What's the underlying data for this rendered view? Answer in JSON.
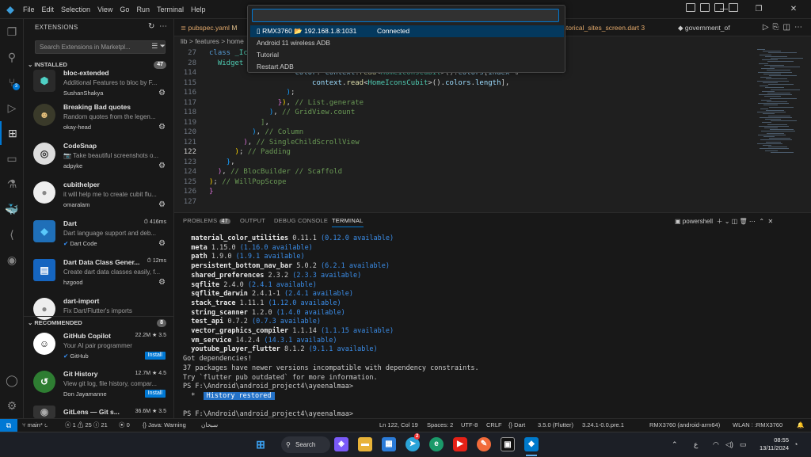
{
  "titlebar": {
    "menus": [
      "File",
      "Edit",
      "Selection",
      "View",
      "Go",
      "Run",
      "Terminal",
      "Help"
    ]
  },
  "quick_pick": {
    "input_value": "",
    "items": [
      {
        "label": "RMX3760 📂 192.168.1.8:1031",
        "status": "Connected"
      },
      {
        "label": "Android 11 wireless ADB"
      },
      {
        "label": "Tutorial"
      },
      {
        "label": "Restart ADB"
      }
    ]
  },
  "sidebar": {
    "title": "EXTENSIONS",
    "search_placeholder": "Search Extensions in Marketpl...",
    "installed_label": "INSTALLED",
    "installed_count": "47",
    "installed": [
      {
        "name": "bloc-extended",
        "desc": "Additional Features to bloc by F...",
        "pub": "SushanShakya",
        "meta": ""
      },
      {
        "name": "Breaking Bad quotes",
        "desc": "Random quotes from the legen...",
        "pub": "okay-head",
        "meta": ""
      },
      {
        "name": "CodeSnap",
        "desc": "📷 Take beautiful screenshots o...",
        "pub": "adpyke",
        "meta": ""
      },
      {
        "name": "cubithelper",
        "desc": "it will help me to create cubit flu...",
        "pub": "omaralam",
        "meta": ""
      },
      {
        "name": "Dart",
        "desc": "Dart language support and deb...",
        "pub": "Dart Code",
        "meta": "416ms"
      },
      {
        "name": "Dart Data Class Gener...",
        "desc": "Create dart data classes easily, f...",
        "pub": "hzgood",
        "meta": "12ms"
      },
      {
        "name": "dart-import",
        "desc": "Fix Dart/Flutter's imports",
        "pub": "",
        "meta": ""
      }
    ],
    "recommended_label": "RECOMMENDED",
    "recommended_count": "8",
    "recommended": [
      {
        "name": "GitHub Copilot",
        "desc": "Your AI pair programmer",
        "pub": "GitHub",
        "meta": "22.2M ★ 3.5",
        "action": "Install"
      },
      {
        "name": "Git History",
        "desc": "View git log, file history, compar...",
        "pub": "Don Jayamanne",
        "meta": "12.7M ★ 4.5",
        "action": "Install"
      },
      {
        "name": "GitLens — Git s...",
        "desc": "",
        "pub": "",
        "meta": "36.6M ★ 3.5",
        "action": ""
      }
    ]
  },
  "tabs": [
    {
      "label": "pubspec.yaml",
      "mark": "M"
    },
    {
      "label": "historical_sites_screen.dart",
      "mark": "3"
    },
    {
      "label": "government_of"
    }
  ],
  "breadcrumb": "lib > features > home",
  "editor": {
    "lines": [
      {
        "n": "27",
        "html": "<span class='c-kw'>class</span> <span class='c-ty'>_Ico</span>"
      },
      {
        "n": "28",
        "html": "  <span class='c-ty'>Widget</span> b"
      },
      {
        "n": "114",
        "html": "                    <span class='c-va'>color</span>: <span class='c-va'>context</span>.<span class='c-fn'>read</span>&lt;<span class='c-ty'>HomeIconsCubit</span>&gt;().<span class='c-va'>colors</span>[<span class='c-va'>index</span> %"
      },
      {
        "n": "115",
        "html": "                        <span class='c-va'>context</span>.<span class='c-fn'>read</span>&lt;<span class='c-ty'>HomeIconsCubit</span>&gt;().<span class='c-va'>colors</span>.<span class='c-va'>length</span>],"
      },
      {
        "n": "116",
        "html": "                  <span class='c-br'>)</span>;"
      },
      {
        "n": "117",
        "html": "                <span class='c-pp'>}</span><span class='c-pn'>)</span>, <span class='c-cm'>// List.generate</span>"
      },
      {
        "n": "118",
        "html": "              <span class='c-br'>)</span>, <span class='c-cm'>// GridView.count</span>"
      },
      {
        "n": "119",
        "html": "            <span class='c-gr'>]</span>,"
      },
      {
        "n": "120",
        "html": "          <span class='c-br'>)</span>, <span class='c-cm'>// Column</span>"
      },
      {
        "n": "121",
        "html": "        <span class='c-pp'>)</span>, <span class='c-cm'>// SingleChildScrollView</span>"
      },
      {
        "n": "122",
        "html": "      <span class='c-pn'>)</span>; <span class='c-cm'>// Padding</span>"
      },
      {
        "n": "123",
        "html": "    <span class='c-br'>}</span>,"
      },
      {
        "n": "124",
        "html": "  <span class='c-pp'>)</span>, <span class='c-cm'>// BlocBuilder // Scaffold</span>"
      },
      {
        "n": "125",
        "html": "<span class='c-pn'>)</span>; <span class='c-cm'>// WillPopScope</span>"
      },
      {
        "n": "126",
        "html": "<span class='c-pp'>}</span>"
      },
      {
        "n": "127",
        "html": ""
      }
    ]
  },
  "panel": {
    "tabs": [
      "PROBLEMS",
      "OUTPUT",
      "DEBUG CONSOLE",
      "TERMINAL"
    ],
    "problems_count": "47",
    "shell": "powershell"
  },
  "terminal": {
    "packages": [
      [
        "material_color_utilities",
        "0.11.1",
        "(0.12.0 available)"
      ],
      [
        "meta",
        "1.15.0",
        "(1.16.0 available)"
      ],
      [
        "path",
        "1.9.0",
        "(1.9.1 available)"
      ],
      [
        "persistent_bottom_nav_bar",
        "5.0.2",
        "(6.2.1 available)"
      ],
      [
        "shared_preferences",
        "2.3.2",
        "(2.3.3 available)"
      ],
      [
        "sqflite",
        "2.4.0",
        "(2.4.1 available)"
      ],
      [
        "sqflite_darwin",
        "2.4.1-1",
        "(2.4.1 available)"
      ],
      [
        "stack_trace",
        "1.11.1",
        "(1.12.0 available)"
      ],
      [
        "string_scanner",
        "1.2.0",
        "(1.4.0 available)"
      ],
      [
        "test_api",
        "0.7.2",
        "(0.7.3 available)"
      ],
      [
        "vector_graphics_compiler",
        "1.1.14",
        "(1.1.15 available)"
      ],
      [
        "vm_service",
        "14.2.4",
        "(14.3.1 available)"
      ],
      [
        "youtube_player_flutter",
        "8.1.2",
        "(9.1.1 available)"
      ]
    ],
    "got": "Got dependencies!",
    "incompatible": "37 packages have newer versions incompatible with dependency constraints.",
    "try": "Try `flutter pub outdated` for more information.",
    "prompt1": "PS F:\\Android\\android_project4\\ayeenalmaa>",
    "history": "History restored",
    "prompt2": "PS F:\\Android\\android_project4\\ayeenalmaa>"
  },
  "status": {
    "branch": "main*",
    "errors": "1",
    "warnings": "25",
    "infos": "21",
    "ports": "0",
    "java": "Java: Warning",
    "arabic": "سبحان",
    "pos": "Ln 122, Col 19",
    "spaces": "Spaces: 2",
    "enc": "UTF-8",
    "eol": "CRLF",
    "lang": "Dart",
    "dartver": "3.5.0 (Flutter)",
    "flutterver": "3.24.1-0.0.pre.1",
    "device": "RMX3760 (android-arm64)",
    "wlan": "WLAN ⫶ :RMX3760"
  },
  "taskbar": {
    "search": "Search",
    "time": "08:55",
    "date": "13/11/2024",
    "lang": "ع",
    "chat_badge": "2"
  },
  "colors": {
    "accent": "#0078d4"
  }
}
